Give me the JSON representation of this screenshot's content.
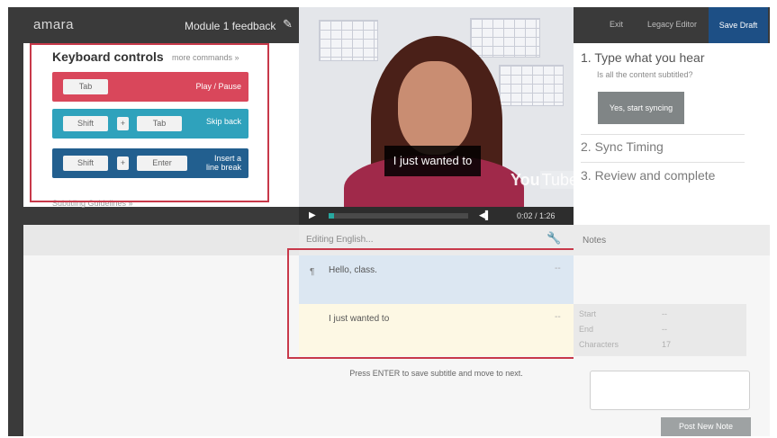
{
  "app": {
    "logo": "amara",
    "module_title": "Module 1 feedback"
  },
  "topbar": {
    "exit_label": "Exit",
    "legacy_editor_label": "Legacy Editor",
    "save_draft_label": "Save Draft"
  },
  "keyboard": {
    "title": "Keyboard controls",
    "more_commands": "more commands »",
    "rows": [
      {
        "keys": [
          "Tab"
        ],
        "action": "Play / Pause",
        "color": "#d9475b"
      },
      {
        "keys": [
          "Shift",
          "+",
          "Tab"
        ],
        "action": "Skip back",
        "color": "#2fa2bc"
      },
      {
        "keys": [
          "Shift",
          "+",
          "Enter"
        ],
        "action_line1": "Insert a",
        "action_line2": "line break",
        "color": "#225f8f"
      }
    ],
    "guidelines": "Subtitling Guidelines »"
  },
  "video": {
    "caption": "I just wanted to",
    "watermark_you": "You",
    "watermark_tube": "Tube",
    "time": "0:02 / 1:26",
    "progress": 0.02
  },
  "steps": {
    "step1": "1.  Type what you hear",
    "step1_sub": "Is all the content subtitled?",
    "sync_button": "Yes, start syncing",
    "step2": "2.  Sync Timing",
    "step3": "3.  Review and complete"
  },
  "editor": {
    "title": "Editing English...",
    "subtitles": [
      {
        "text": "Hello, class.",
        "paragraph_mark": "¶",
        "timing": "--"
      },
      {
        "text": "I just wanted to",
        "timing": "--"
      }
    ],
    "hint": "Press ENTER to save subtitle and move to next."
  },
  "notes": {
    "title": "Notes",
    "meta": [
      {
        "label": "Start",
        "value": "--"
      },
      {
        "label": "End",
        "value": "--"
      },
      {
        "label": "Characters",
        "value": "17"
      }
    ],
    "post_button": "Post New Note"
  },
  "colors": {
    "accent_blue": "#1d4f85",
    "highlight_red": "#c8394a"
  }
}
